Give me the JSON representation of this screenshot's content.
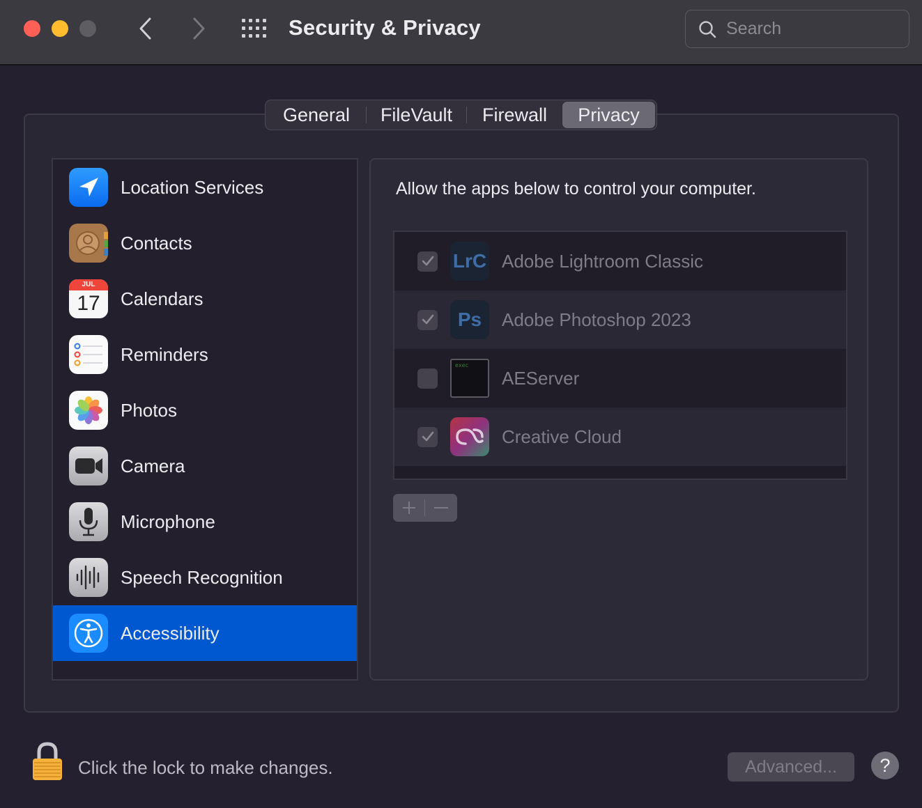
{
  "window": {
    "title": "Security & Privacy",
    "search_placeholder": "Search"
  },
  "tabs": [
    {
      "label": "General",
      "selected": false
    },
    {
      "label": "FileVault",
      "selected": false
    },
    {
      "label": "Firewall",
      "selected": false
    },
    {
      "label": "Privacy",
      "selected": true
    }
  ],
  "sidebar": {
    "items": [
      {
        "label": "Location Services",
        "icon": "location-arrow-icon"
      },
      {
        "label": "Contacts",
        "icon": "contacts-icon"
      },
      {
        "label": "Calendars",
        "icon": "calendar-icon",
        "month": "JUL",
        "day": "17"
      },
      {
        "label": "Reminders",
        "icon": "reminders-icon"
      },
      {
        "label": "Photos",
        "icon": "photos-icon"
      },
      {
        "label": "Camera",
        "icon": "camera-icon"
      },
      {
        "label": "Microphone",
        "icon": "microphone-icon"
      },
      {
        "label": "Speech Recognition",
        "icon": "waveform-icon"
      },
      {
        "label": "Accessibility",
        "icon": "accessibility-icon",
        "selected": true
      }
    ]
  },
  "content": {
    "description": "Allow the apps below to control your computer.",
    "apps": [
      {
        "name": "Adobe Lightroom Classic",
        "checked": true,
        "icon_text": "LrC"
      },
      {
        "name": "Adobe Photoshop 2023",
        "checked": true,
        "icon_text": "Ps"
      },
      {
        "name": "AEServer",
        "checked": false,
        "icon_text": "exec"
      },
      {
        "name": "Creative Cloud",
        "checked": true,
        "icon_text": ""
      }
    ]
  },
  "footer": {
    "lock_text": "Click the lock to make changes.",
    "advanced_label": "Advanced...",
    "help_label": "?"
  },
  "colors": {
    "accent": "#0058d1",
    "background": "#242030",
    "close": "#fe5f57",
    "minimize": "#febc2e"
  }
}
